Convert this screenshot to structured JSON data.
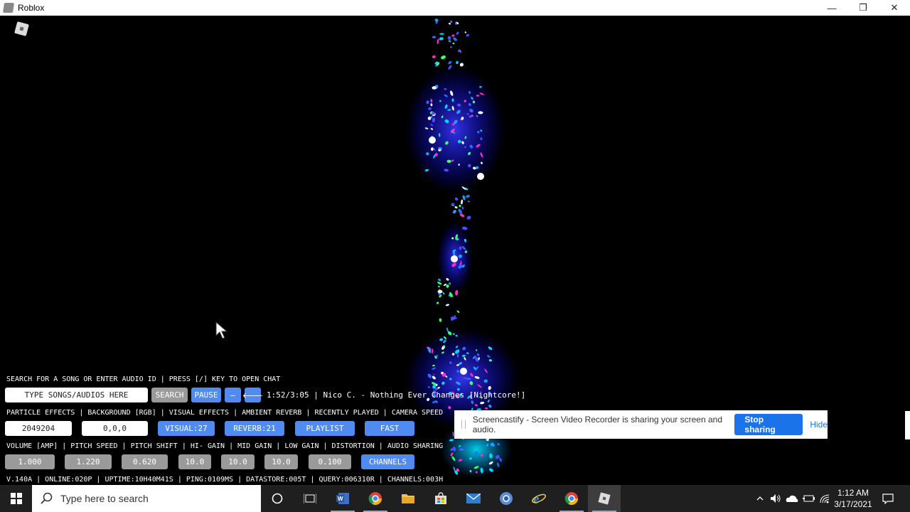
{
  "window": {
    "title": "Roblox",
    "minimize": "—",
    "maximize": "❐",
    "close": "✕"
  },
  "hud": {
    "search_hint": "SEARCH FOR A SONG OR ENTER AUDIO ID | PRESS [/] KEY TO OPEN CHAT",
    "search_placeholder": "TYPE SONGS/AUDIOS HERE",
    "search_btn": "SEARCH",
    "pause_btn": "PAUSE",
    "minus_btn": "—",
    "back_btn": "🡐",
    "now_playing": "1:52/3:05 | Nico C. - Nothing Ever Changes [Nightcore!]",
    "row1_labels": "PARTICLE EFFECTS | BACKGROUND [RGB] | VISUAL EFFECTS | AMBIENT REVERB | RECENTLY PLAYED | CAMERA SPEED",
    "particle_effects": "2049204",
    "background_rgb": "0,0,0",
    "visual_btn": "VISUAL:27",
    "reverb_btn": "REVERB:21",
    "playlist_btn": "PLAYLIST",
    "camera_btn": "FAST",
    "row2_labels": "VOLUME [AMP] | PITCH SPEED | PITCH SHIFT | HI- GAIN | MID GAIN | LOW GAIN | DISTORTION | AUDIO SHARING",
    "volume": "1.000",
    "pitch_speed": "1.220",
    "pitch_shift": "0.620",
    "hi_gain": "10.0",
    "mid_gain": "10.0",
    "low_gain": "10.0",
    "distortion": "0.100",
    "channels_btn": "CHANNELS",
    "status": "V.140A | ONLINE:020P | UPTIME:10H40M41S | PING:0109MS | DATASTORE:005T | QUERY:006310R | CHANNELS:003H"
  },
  "screencastify": {
    "message": "Screencastify - Screen Video Recorder is sharing your screen and audio.",
    "stop": "Stop sharing",
    "hide": "Hide"
  },
  "taskbar": {
    "search_placeholder": "Type here to search",
    "time": "1:12 AM",
    "date": "3/17/2021"
  },
  "colors": {
    "accent_blue": "#4f8bf0",
    "button_gray": "#9a9a9a",
    "stop_blue": "#1a73e8"
  }
}
